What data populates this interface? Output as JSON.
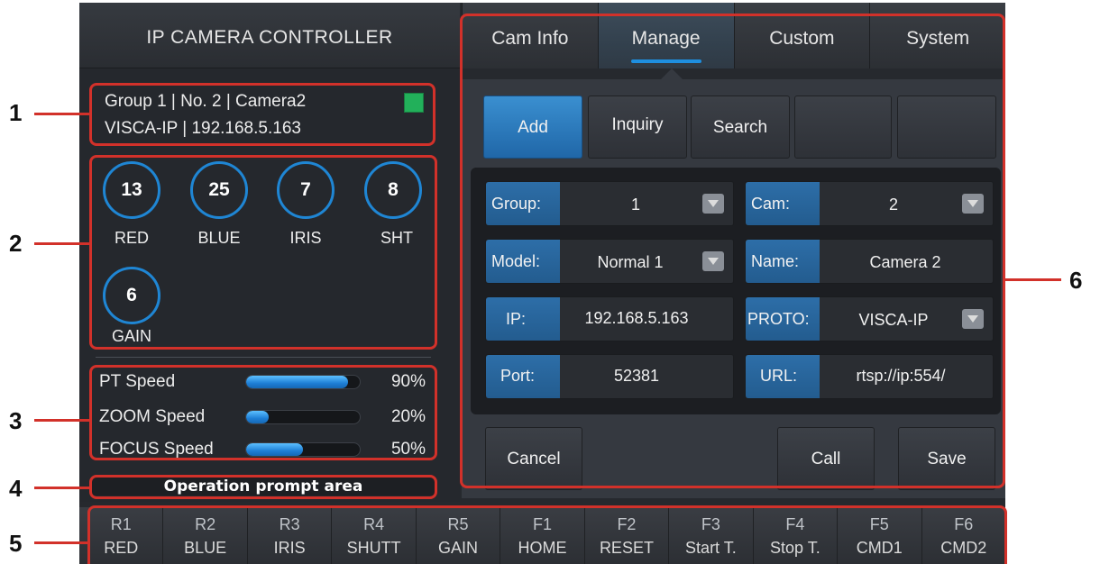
{
  "app_title": "IP CAMERA CONTROLLER",
  "tabs": [
    {
      "label": "Cam Info"
    },
    {
      "label": "Manage",
      "active": true
    },
    {
      "label": "Custom"
    },
    {
      "label": "System"
    }
  ],
  "camera_info": {
    "line1": "Group 1 | No. 2 | Camera2",
    "line2": "VISCA-IP | 192.168.5.163",
    "status_color": "#22b05a"
  },
  "dials": [
    {
      "value": "13",
      "label": "RED"
    },
    {
      "value": "25",
      "label": "BLUE"
    },
    {
      "value": "7",
      "label": "IRIS"
    },
    {
      "value": "8",
      "label": "SHT"
    },
    {
      "value": "6",
      "label": "GAIN"
    }
  ],
  "speeds": [
    {
      "label": "PT Speed",
      "percent_text": "90%",
      "value": 0.9
    },
    {
      "label": "ZOOM Speed",
      "percent_text": "20%",
      "value": 0.2
    },
    {
      "label": "FOCUS Speed",
      "percent_text": "50%",
      "value": 0.5
    }
  ],
  "prompt_area": "Operation prompt area",
  "manage": {
    "top_buttons": [
      {
        "label": "Add",
        "active": true
      },
      {
        "label": "Inquiry"
      },
      {
        "label": "Search"
      },
      {
        "label": ""
      },
      {
        "label": ""
      }
    ],
    "fields": {
      "group": {
        "label": "Group:",
        "value": "1"
      },
      "cam": {
        "label": "Cam:",
        "value": "2"
      },
      "model": {
        "label": "Model:",
        "value": "Normal 1"
      },
      "name": {
        "label": "Name:",
        "value": "Camera 2"
      },
      "ip": {
        "label": "IP:",
        "value": "192.168.5.163"
      },
      "proto": {
        "label": "PROTO:",
        "value": "VISCA-IP"
      },
      "port": {
        "label": "Port:",
        "value": "52381"
      },
      "url": {
        "label": "URL:",
        "value": "rtsp://ip:554/"
      }
    },
    "actions": {
      "cancel": "Cancel",
      "call": "Call",
      "save": "Save"
    }
  },
  "function_keys": [
    {
      "key": "R1",
      "label": "RED"
    },
    {
      "key": "R2",
      "label": "BLUE"
    },
    {
      "key": "R3",
      "label": "IRIS"
    },
    {
      "key": "R4",
      "label": "SHUTT"
    },
    {
      "key": "R5",
      "label": "GAIN"
    },
    {
      "key": "F1",
      "label": "HOME"
    },
    {
      "key": "F2",
      "label": "RESET"
    },
    {
      "key": "F3",
      "label": "Start T."
    },
    {
      "key": "F4",
      "label": "Stop T."
    },
    {
      "key": "F5",
      "label": "CMD1"
    },
    {
      "key": "F6",
      "label": "CMD2"
    }
  ],
  "callouts": [
    "1",
    "2",
    "3",
    "4",
    "5",
    "6"
  ],
  "annotation_color": "#d2312a"
}
